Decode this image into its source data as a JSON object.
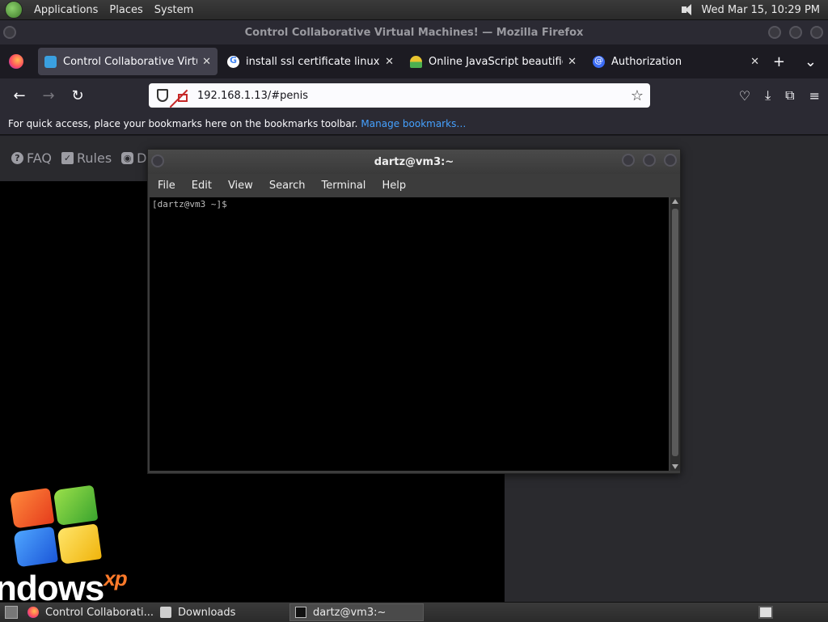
{
  "top_panel": {
    "menus": [
      "Applications",
      "Places",
      "System"
    ],
    "clock": "Wed Mar 15, 10:29 PM"
  },
  "firefox": {
    "window_title": "Control Collaborative Virtual Machines! — Mozilla Firefox",
    "tabs": [
      {
        "label": "Control Collaborative Virtua",
        "icon": "monitor-icon"
      },
      {
        "label": "install ssl certificate linux - G",
        "icon": "google-icon"
      },
      {
        "label": "Online JavaScript beautifier",
        "icon": "js-beautifier-icon"
      },
      {
        "label": "Authorization",
        "icon": "at-sign-icon"
      }
    ],
    "url": "192.168.1.13/#penis",
    "bookmarks_text": "For quick access, place your bookmarks here on the bookmarks toolbar.",
    "bookmarks_link": "Manage bookmarks…"
  },
  "site_nav": {
    "faq": "FAQ",
    "rules": "Rules",
    "discord": "D"
  },
  "vm_screen": {
    "logo_text": "ndows",
    "logo_super": "xp"
  },
  "terminal": {
    "title": "dartz@vm3:~",
    "menus": [
      "File",
      "Edit",
      "View",
      "Search",
      "Terminal",
      "Help"
    ],
    "prompt": "[dartz@vm3 ~]$"
  },
  "taskbar": {
    "items": [
      "Control Collaborati...",
      "Downloads",
      "dartz@vm3:~"
    ]
  }
}
